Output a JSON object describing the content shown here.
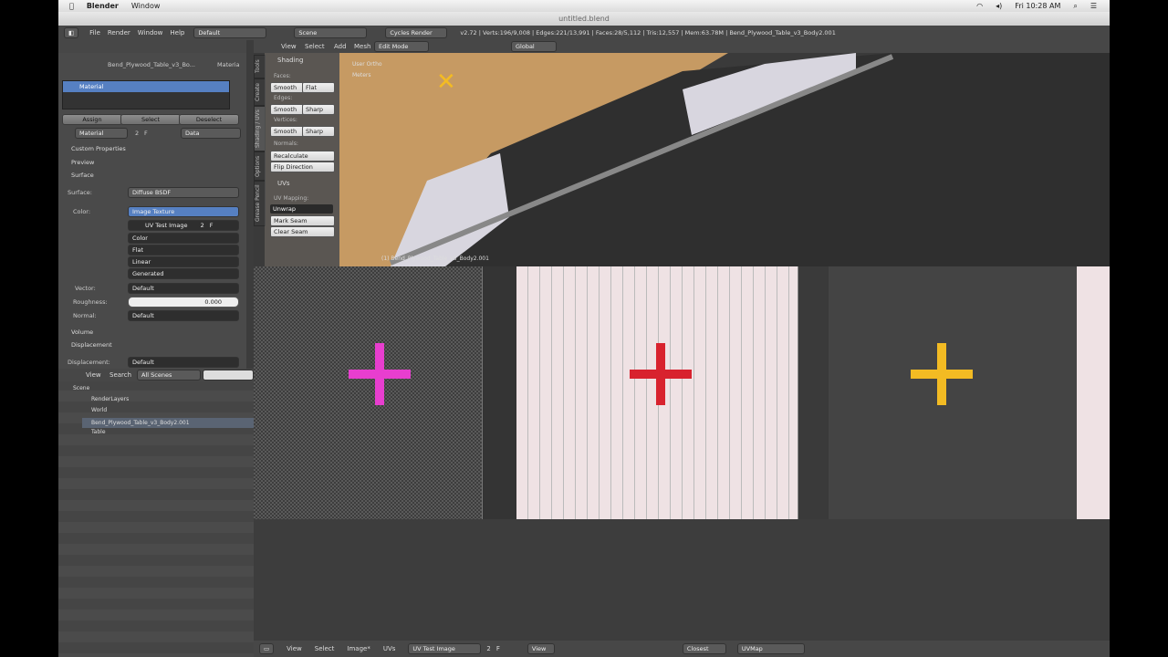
{
  "mac_menu": {
    "app": "Blender",
    "window": "Window",
    "clock": "Fri 10:28 AM"
  },
  "window_title": "untitled.blend",
  "info_header": {
    "menus": [
      "File",
      "Render",
      "Window",
      "Help"
    ],
    "screen_layout": "Default",
    "scene": "Scene",
    "render_engine": "Cycles Render",
    "stats": "v2.72 | Verts:196/9,008 | Edges:221/13,991 | Faces:28/5,112 | Tris:12,557 | Mem:63.78M | Bend_Plywood_Table_v3_Body2.001"
  },
  "viewport_header": {
    "menus": [
      "View",
      "Select",
      "Add",
      "Mesh"
    ],
    "mode": "Edit Mode",
    "orientation": "Global"
  },
  "properties": {
    "breadcrumb_object": "Bend_Plywood_Table_v3_Bo...",
    "breadcrumb_material": "Materia",
    "material_slot": "Material",
    "assign": "Assign",
    "select": "Select",
    "deselect": "Deselect",
    "material_name": "Material",
    "users": "2",
    "fake_user": "F",
    "link": "Data",
    "sections": {
      "custom_properties": "Custom Properties",
      "preview": "Preview",
      "surface": "Surface",
      "volume": "Volume",
      "displacement": "Displacement"
    },
    "surface_label": "Surface:",
    "surface_value": "Diffuse BSDF",
    "color_label": "Color:",
    "color_value": "Image Texture",
    "image_name": "UV Test Image",
    "image_users": "2",
    "image_fake": "F",
    "opt1": "Color",
    "opt2": "Flat",
    "opt3": "Linear",
    "opt4": "Generated",
    "vector_label": "Vector:",
    "vector_value": "Default",
    "roughness_label": "Roughness:",
    "roughness_value": "0.000",
    "normal_label": "Normal:",
    "normal_value": "Default",
    "displacement_label": "Displacement:",
    "displacement_value": "Default"
  },
  "outliner": {
    "header": {
      "view": "View",
      "search": "Search",
      "filter": "All Scenes"
    },
    "items": [
      {
        "label": "Scene"
      },
      {
        "label": "RenderLayers"
      },
      {
        "label": "World"
      },
      {
        "label": "Bend_Plywood_Table_v3_Body2.001"
      },
      {
        "label": "Table"
      }
    ]
  },
  "toolshelf": {
    "tabs": [
      "Tools",
      "Create",
      "Shading / UVs",
      "Options",
      "Grease Pencil"
    ],
    "shading_title": "Shading",
    "faces": "Faces:",
    "edges": "Edges:",
    "vertices": "Vertices:",
    "smooth": "Smooth",
    "flat": "Flat",
    "sharp": "Sharp",
    "normals": "Normals:",
    "recalculate": "Recalculate",
    "flip": "Flip Direction",
    "uvs_title": "UVs",
    "uv_mapping": "UV Mapping:",
    "unwrap": "Unwrap",
    "mark_seam": "Mark Seam",
    "clear_seam": "Clear Seam"
  },
  "viewport": {
    "view_name": "User Ortho",
    "units": "Meters",
    "object_label": "(1) Bend_Plywood_Table_v3_Body2.001"
  },
  "uv_header": {
    "menus": [
      "View",
      "Select",
      "Image*",
      "UVs"
    ],
    "image": "UV Test Image",
    "users": "2",
    "fake": "F",
    "view_menu": "View",
    "pivot": "Closest",
    "uvmap": "UVMap"
  },
  "colors": {
    "magenta": "#e83ecf",
    "red": "#d8222e",
    "yellow": "#f3bb23",
    "selection_blue": "#5680c2"
  }
}
